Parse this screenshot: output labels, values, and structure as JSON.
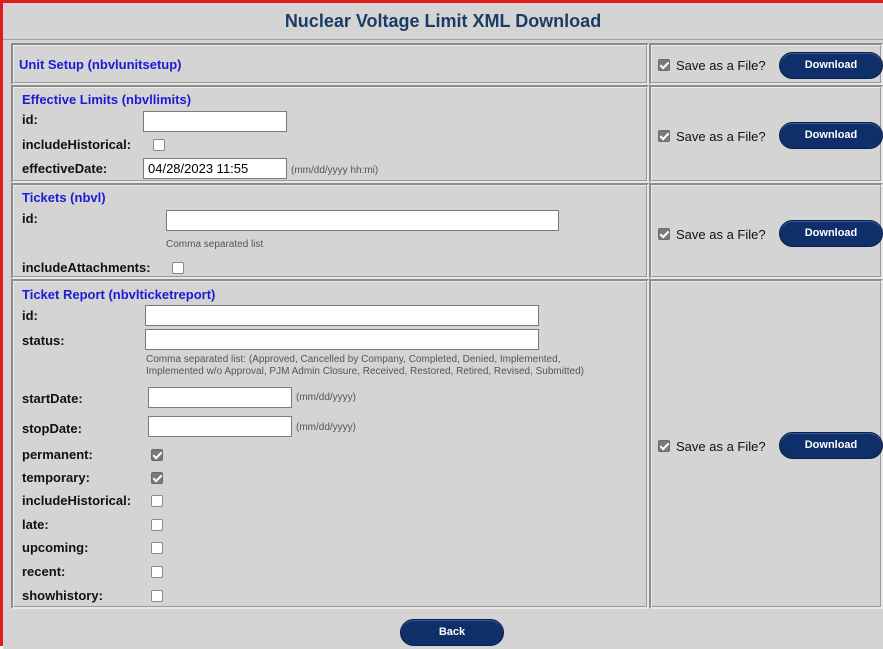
{
  "page": {
    "title": "Nuclear Voltage Limit XML Download"
  },
  "common": {
    "save_label": "Save as a File?",
    "download_label": "Download"
  },
  "unit_setup": {
    "title": "Unit Setup (nbvlunitsetup)"
  },
  "effective_limits": {
    "title": "Effective Limits (nbvllimits)",
    "id_label": "id:",
    "id_value": "",
    "include_historical_label": "includeHistorical:",
    "effective_date_label": "effectiveDate:",
    "effective_date_value": "04/28/2023 11:55",
    "effective_date_hint": "(mm/dd/yyyy hh:mi)"
  },
  "tickets": {
    "title": "Tickets (nbvl)",
    "id_label": "id:",
    "id_value": "",
    "id_hint": "Comma separated list",
    "include_attachments_label": "includeAttachments:"
  },
  "ticket_report": {
    "title": "Ticket Report (nbvlticketreport)",
    "id_label": "id:",
    "status_label": "status:",
    "status_hint_line1": "Comma separated list: (Approved, Cancelled by Company, Completed, Denied, Implemented,",
    "status_hint_line2": "Implemented w/o Approval, PJM Admin Closure, Received, Restored, Retired, Revised, Submitted)",
    "start_date_label": "startDate:",
    "start_date_hint": "(mm/dd/yyyy)",
    "stop_date_label": "stopDate:",
    "stop_date_hint": "(mm/dd/yyyy)",
    "permanent_label": "permanent:",
    "temporary_label": "temporary:",
    "include_historical_label": "includeHistorical:",
    "late_label": "late:",
    "upcoming_label": "upcoming:",
    "recent_label": "recent:",
    "showhistory_label": "showhistory:"
  },
  "footer": {
    "back_label": "Back"
  }
}
